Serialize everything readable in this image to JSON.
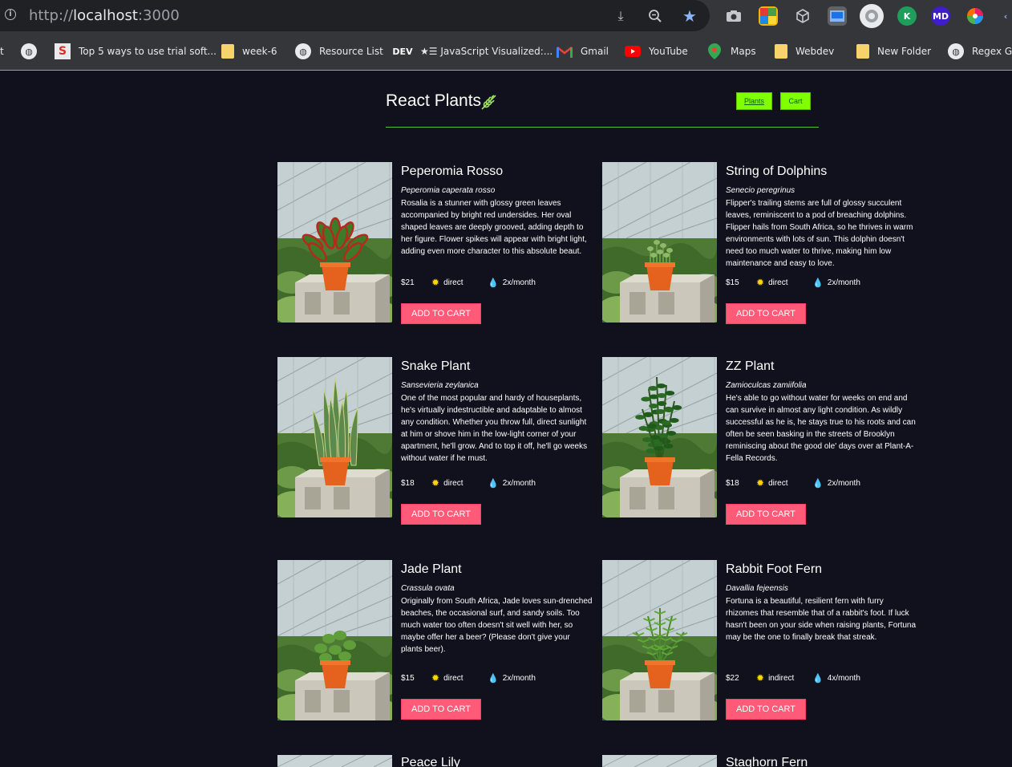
{
  "browser": {
    "url_scheme": "http://",
    "url_host": "localhost",
    "url_port": ":3000",
    "bookmarks": [
      {
        "label": "Top 5 ways to use trial soft...",
        "icon": "s-logo-icon"
      },
      {
        "label": "week-6",
        "icon": "folder-icon"
      },
      {
        "label": "Resource List",
        "icon": "globe-icon"
      },
      {
        "label": "★☰ JavaScript Visualized:...",
        "icon": "dev-icon",
        "icon_text": "DEV"
      },
      {
        "label": "Gmail",
        "icon": "gmail-icon"
      },
      {
        "label": "YouTube",
        "icon": "youtube-icon"
      },
      {
        "label": "Maps",
        "icon": "maps-icon"
      },
      {
        "label": "Webdev",
        "icon": "folder-icon"
      },
      {
        "label": "New Folder",
        "icon": "folder-icon"
      },
      {
        "label": "Regex Go",
        "icon": "globe-icon"
      }
    ],
    "extension_labels": {
      "md": "MD",
      "k": "K"
    }
  },
  "header": {
    "title": "React Plants",
    "nav": [
      {
        "label": "Plants"
      },
      {
        "label": "Cart"
      }
    ]
  },
  "plants": [
    {
      "name": "Peperomia Rosso",
      "scientific": "Peperomia caperata rosso",
      "description": "Rosalia is a stunner with glossy green leaves accompanied by bright red undersides. Her oval shaped leaves are deeply grooved, adding depth to her figure. Flower spikes will appear with bright light, adding even more character to this absolute beaut.",
      "price": "$21",
      "light": "direct",
      "water": "2x/month",
      "button": "ADD TO CART"
    },
    {
      "name": "String of Dolphins",
      "scientific": "Senecio peregrinus",
      "description": "Flipper's trailing stems are full of glossy succulent leaves, reminiscent to a pod of breaching dolphins. Flipper hails from South Africa, so he thrives in warm environments with lots of sun. This dolphin doesn't need too much water to thrive, making him low maintenance and easy to love.",
      "price": "$15",
      "light": "direct",
      "water": "2x/month",
      "button": "ADD TO CART"
    },
    {
      "name": "Snake Plant",
      "scientific": "Sansevieria zeylanica",
      "description": "One of the most popular and hardy of houseplants, he's virtually indestructible and adaptable to almost any condition. Whether you throw full, direct sunlight at him or shove him in the low-light corner of your apartment, he'll grow. And to top it off, he'll go weeks without water if he must.",
      "price": "$18",
      "light": "direct",
      "water": "2x/month",
      "button": "ADD TO CART"
    },
    {
      "name": "ZZ Plant",
      "scientific": "Zamioculcas zamiifolia",
      "description": "He's able to go without water for weeks on end and can survive in almost any light condition. As wildly successful as he is, he stays true to his roots and can often be seen basking in the streets of Brooklyn reminiscing about the good ole' days over at Plant-A-Fella Records.",
      "price": "$18",
      "light": "direct",
      "water": "2x/month",
      "button": "ADD TO CART"
    },
    {
      "name": "Jade Plant",
      "scientific": "Crassula ovata",
      "description": "Originally from South Africa, Jade loves sun-drenched beaches, the occasional surf, and sandy soils. Too much water too often doesn't sit well with her, so maybe offer her a beer? (Please don't give your plants beer).",
      "price": "$15",
      "light": "direct",
      "water": "2x/month",
      "button": "ADD TO CART"
    },
    {
      "name": "Rabbit Foot Fern",
      "scientific": "Davallia fejeensis",
      "description": "Fortuna is a beautiful, resilient fern with furry rhizomes that resemble that of a rabbit's foot. If luck hasn't been on your side when raising plants, Fortuna may be the one to finally break that streak.",
      "price": "$22",
      "light": "indirect",
      "water": "4x/month",
      "button": "ADD TO CART"
    }
  ],
  "partial_titles": [
    "Peace Lily",
    "Staghorn Fern"
  ]
}
